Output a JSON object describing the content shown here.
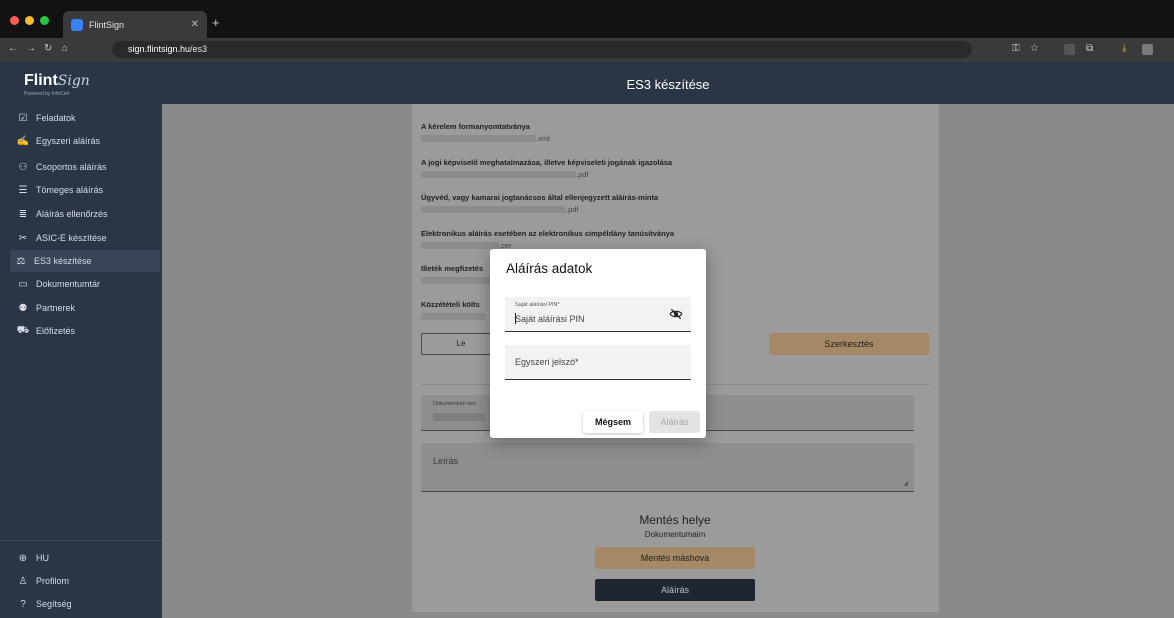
{
  "browser": {
    "tab_title": "FlintSign",
    "url_domain": "sign.flintsign.hu",
    "url_path": "/es3",
    "traffic_colors": [
      "#ff5f57",
      "#febc2e",
      "#28c840"
    ]
  },
  "app": {
    "logo_main": "Flint",
    "logo_script": "Sign",
    "logo_sub": "Powered by InfoCert",
    "header_title": "ES3 készítése"
  },
  "sidebar": {
    "items": [
      {
        "label": "Feladatok",
        "icon": "task-icon"
      },
      {
        "label": "Egyszeri aláírás",
        "icon": "signature-icon"
      },
      {
        "label": "Csoportos aláírás",
        "icon": "group-icon"
      },
      {
        "label": "Tömeges aláírás",
        "icon": "list-check-icon"
      },
      {
        "label": "Aláírás ellenőrzés",
        "icon": "verify-icon"
      },
      {
        "label": "ASIC-E készítése",
        "icon": "tools-icon"
      },
      {
        "label": "ES3 készítése",
        "icon": "stamp-icon"
      },
      {
        "label": "Dokumentumtár",
        "icon": "folder-icon"
      },
      {
        "label": "Partnerek",
        "icon": "partners-icon"
      },
      {
        "label": "Előfizetés",
        "icon": "cart-icon"
      }
    ],
    "bottom": [
      {
        "label": "HU",
        "icon": "globe-icon"
      },
      {
        "label": "Profilom",
        "icon": "user-icon"
      },
      {
        "label": "Segítség",
        "icon": "help-icon"
      }
    ]
  },
  "form": {
    "docs": [
      {
        "title": "A kérelem formanyomtatványa",
        "ext": ".xml"
      },
      {
        "title": "A jogi képviselő meghatalmazása, illetve képviseleti jogának igazolása",
        "ext": ".pdf"
      },
      {
        "title": "Ügyvéd, vagy kamarai jogtanácsos által ellenjegyzett aláírás-minta",
        "ext": ".pdf"
      },
      {
        "title": "Elektronikus aláírás esetében az elektronikus cimpéldány tanúsítványa",
        "ext": ".cer"
      },
      {
        "title": "Illeték megfizetés",
        "ext": ""
      },
      {
        "title": "Közzétételi költs",
        "ext": ""
      }
    ],
    "left_button_label": "Le",
    "edit_button_label": "Szerkesztés",
    "doc_name_label": "Dokumentum nev",
    "description_label": "Leírás",
    "save_location_title": "Mentés helye",
    "save_location_value": "Dokumentumaim",
    "save_elsewhere_label": "Mentés máshova",
    "sign_button_label": "Aláírás"
  },
  "dialog": {
    "title": "Aláírás adatok",
    "pin_label": "Saját aláírási PIN*",
    "pin_placeholder": "Saját aláírási PIN",
    "otp_placeholder": "Egyszeri jelszó*",
    "cancel_label": "Mégsem",
    "sign_label": "Aláírás"
  }
}
